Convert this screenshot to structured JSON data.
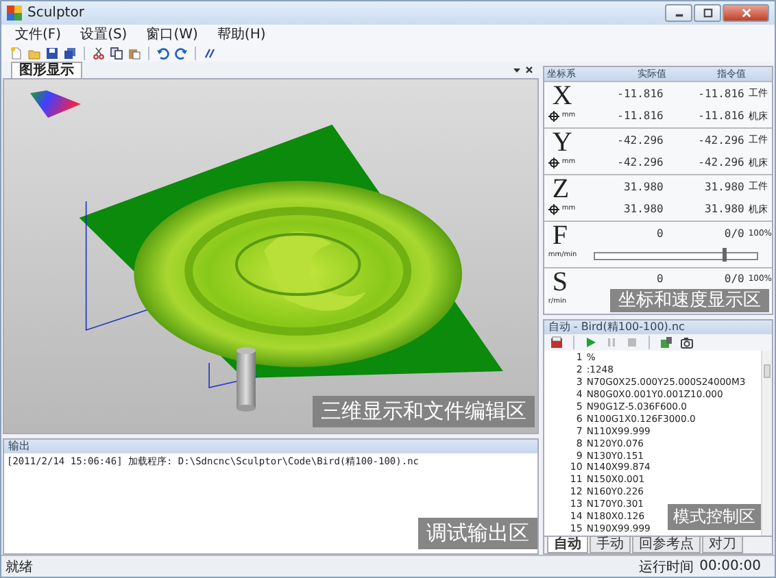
{
  "window": {
    "title": "Sculptor"
  },
  "menu": [
    "文件(F)",
    "设置(S)",
    "窗口(W)",
    "帮助(H)"
  ],
  "view_tabs": [
    {
      "label": "图形显示",
      "selected": true
    }
  ],
  "viewport_overlay": "三维显示和文件编辑区",
  "output": {
    "title": "输出",
    "lines": [
      "[2011/2/14 15:06:46] 加载程序: D:\\Sdncnc\\Sculptor\\Code\\Bird(精100-100).nc"
    ],
    "overlay": "调试输出区"
  },
  "coordinates": {
    "columns": [
      "坐标系",
      "实际值",
      "指令值"
    ],
    "axes": [
      {
        "axis": "X",
        "unit": "mm",
        "rows": [
          {
            "actual": "-11.816",
            "command": "-11.816",
            "frame": "工件"
          },
          {
            "actual": "-11.816",
            "command": "-11.816",
            "frame": "机床"
          }
        ]
      },
      {
        "axis": "Y",
        "unit": "mm",
        "rows": [
          {
            "actual": "-42.296",
            "command": "-42.296",
            "frame": "工件"
          },
          {
            "actual": "-42.296",
            "command": "-42.296",
            "frame": "机床"
          }
        ]
      },
      {
        "axis": "Z",
        "unit": "mm",
        "rows": [
          {
            "actual": "31.980",
            "command": "31.980",
            "frame": "工件"
          },
          {
            "actual": "31.980",
            "command": "31.980",
            "frame": "机床"
          }
        ]
      }
    ],
    "speeds": [
      {
        "axis": "F",
        "unit": "mm/min",
        "actual": "0",
        "command": "0/0",
        "percent": "100%",
        "level": 0.8
      },
      {
        "axis": "S",
        "unit": "r/min",
        "actual": "0",
        "command": "0/0",
        "percent": "100%"
      }
    ],
    "overlay": "坐标和速度显示区"
  },
  "mode_panel": {
    "title": "自动 - Bird(精100-100).nc",
    "code_lines": [
      {
        "number": "1",
        "text": "%"
      },
      {
        "number": "2",
        "text": ":1248"
      },
      {
        "number": "3",
        "text": "N70G0X25.000Y25.000S24000M3"
      },
      {
        "number": "4",
        "text": "N80G0X0.001Y0.001Z10.000"
      },
      {
        "number": "5",
        "text": "N90G1Z-5.036F600.0"
      },
      {
        "number": "6",
        "text": "N100G1X0.126F3000.0"
      },
      {
        "number": "7",
        "text": "N110X99.999"
      },
      {
        "number": "8",
        "text": "N120Y0.076"
      },
      {
        "number": "9",
        "text": "N130Y0.151"
      },
      {
        "number": "10",
        "text": "N140X99.874"
      },
      {
        "number": "11",
        "text": "N150X0.001"
      },
      {
        "number": "12",
        "text": "N160Y0.226"
      },
      {
        "number": "13",
        "text": "N170Y0.301"
      },
      {
        "number": "14",
        "text": "N180X0.126"
      },
      {
        "number": "15",
        "text": "N190X99.999"
      }
    ],
    "tabs": [
      {
        "label": "自动",
        "selected": true
      },
      {
        "label": "手动",
        "selected": false
      },
      {
        "label": "回参考点",
        "selected": false
      },
      {
        "label": "对刀",
        "selected": false
      }
    ],
    "overlay": "模式控制区"
  },
  "status_bar": {
    "status": "就绪",
    "runtime_label": "运行时间",
    "runtime": "00:00:00"
  }
}
